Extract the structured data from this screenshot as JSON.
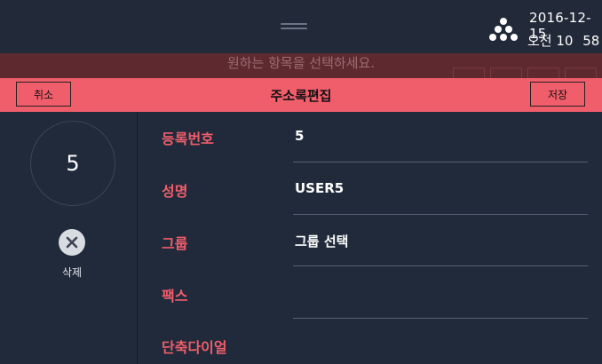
{
  "status": {
    "date": "2016-12-15",
    "time_prefix": "오전",
    "time_value": "10 58",
    "brand_icon": "dots-cluster-icon"
  },
  "background": {
    "hint": "원하는 항목을 선택하세요."
  },
  "edit_bar": {
    "title": "주소록편집",
    "cancel_label": "취소",
    "save_label": "저장",
    "accent_color": "#f05d6b"
  },
  "entry": {
    "number": "5",
    "delete_label": "삭제",
    "delete_icon": "close-icon"
  },
  "fields": [
    {
      "label": "등록번호",
      "value": "5"
    },
    {
      "label": "성명",
      "value": "USER5"
    },
    {
      "label": "그룹",
      "value": "그룹 선택"
    },
    {
      "label": "팩스",
      "value": ""
    },
    {
      "label": "단축다이얼",
      "value": ""
    }
  ]
}
